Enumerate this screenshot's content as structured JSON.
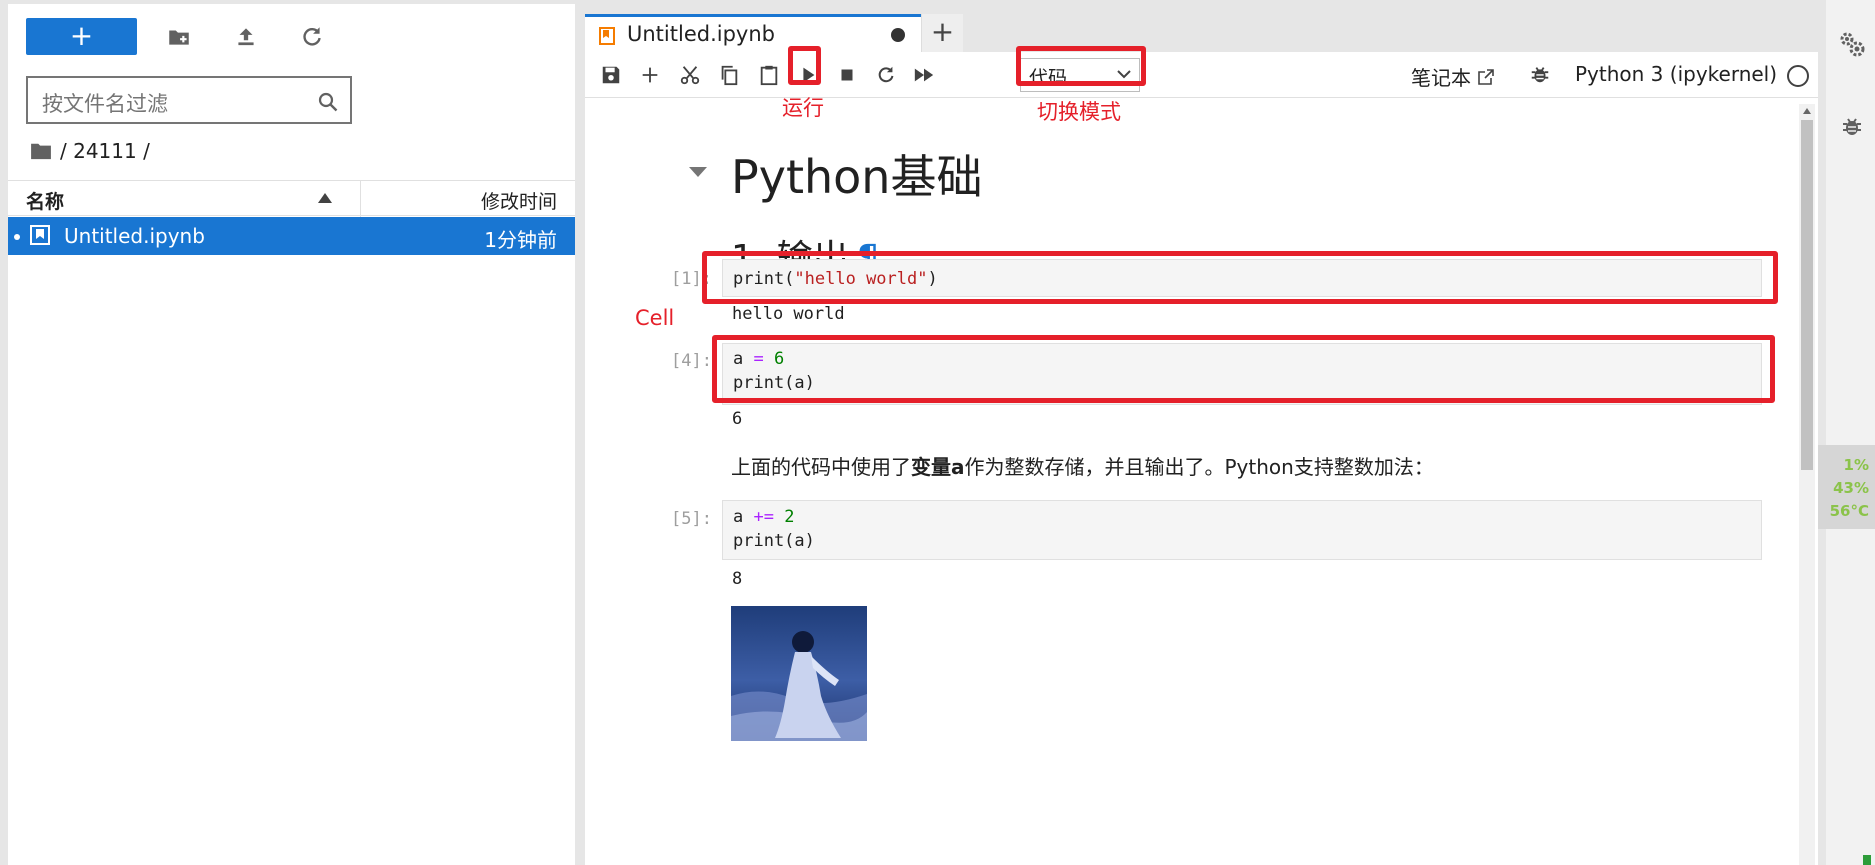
{
  "file_browser": {
    "new_label": "+",
    "filter_placeholder": "按文件名过滤",
    "breadcrumb": "/ 24111 /",
    "col_name": "名称",
    "col_modified": "修改时间",
    "files": [
      {
        "name": "Untitled.ipynb",
        "modified": "1分钟前"
      }
    ]
  },
  "notebook": {
    "tab_title": "Untitled.ipynb",
    "cell_type": "代码",
    "notebook_link": "笔记本",
    "kernel": "Python 3 (ipykernel)"
  },
  "annotations": {
    "run": "运行",
    "switch_mode": "切换模式",
    "cell": "Cell"
  },
  "cells": {
    "h1": "Python基础",
    "h2": "1. 输出",
    "h2_anchor": "¶",
    "c1_prompt": "[1]:",
    "c1_func": "print(",
    "c1_str": "\"hello world\"",
    "c1_close": ")",
    "c1_out": "hello world",
    "c2_prompt": "[4]:",
    "c2_l1_var": "a ",
    "c2_l1_op": "=",
    "c2_l1_num": " 6",
    "c2_l2": "print(a)",
    "c2_out": "6",
    "md_pre": "上面的代码中使用了",
    "md_bold": "变量a",
    "md_post": "作为整数存储，并且输出了。Python支持整数加法：",
    "c3_prompt": "[5]:",
    "c3_l1_var": "a ",
    "c3_l1_op": "+=",
    "c3_l1_num": " 2",
    "c3_l2": "print(a)",
    "c3_out": "8"
  },
  "sysmon": {
    "cpu": "1%",
    "mem": "43%",
    "temp": "56°C"
  },
  "colors": {
    "accent": "#1976d2",
    "annotation_red": "#e5202a"
  }
}
